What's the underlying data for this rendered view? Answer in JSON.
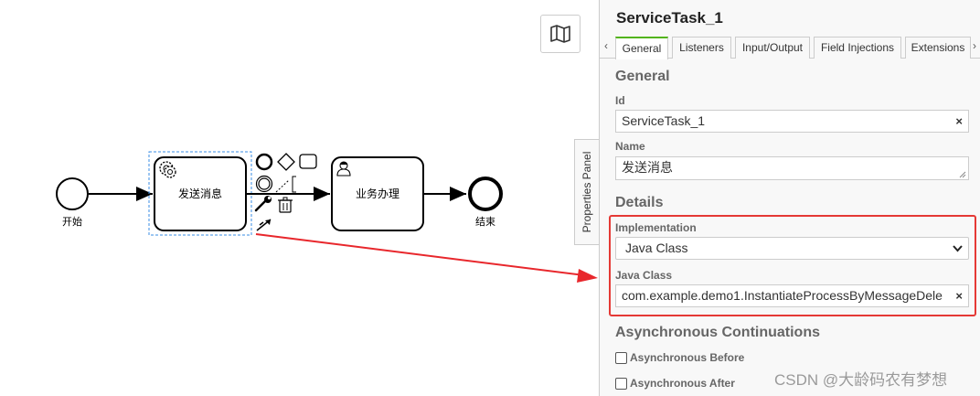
{
  "canvas": {
    "start_label": "开始",
    "task1_label": "发送消息",
    "task2_label": "业务办理",
    "end_label": "结束",
    "map_icon": "map-icon"
  },
  "panel_toggle_label": "Properties Panel",
  "panel": {
    "title": "ServiceTask_1",
    "tabs": [
      "General",
      "Listeners",
      "Input/Output",
      "Field Injections",
      "Extensions"
    ],
    "active_tab": "General",
    "general_title": "General",
    "id_label": "Id",
    "id_value": "ServiceTask_1",
    "name_label": "Name",
    "name_value": "发送消息",
    "details_title": "Details",
    "implementation_label": "Implementation",
    "implementation_value": "Java Class",
    "java_class_label": "Java Class",
    "java_class_value": "com.example.demo1.InstantiateProcessByMessageDele",
    "async_title": "Asynchronous Continuations",
    "async_before_label": "Asynchronous Before",
    "async_after_label": "Asynchronous After"
  },
  "watermark": "CSDN @大龄码农有梦想",
  "colors": {
    "accent_tab": "#52b415",
    "highlight": "#e53935",
    "selection": "#3a8ee6"
  }
}
